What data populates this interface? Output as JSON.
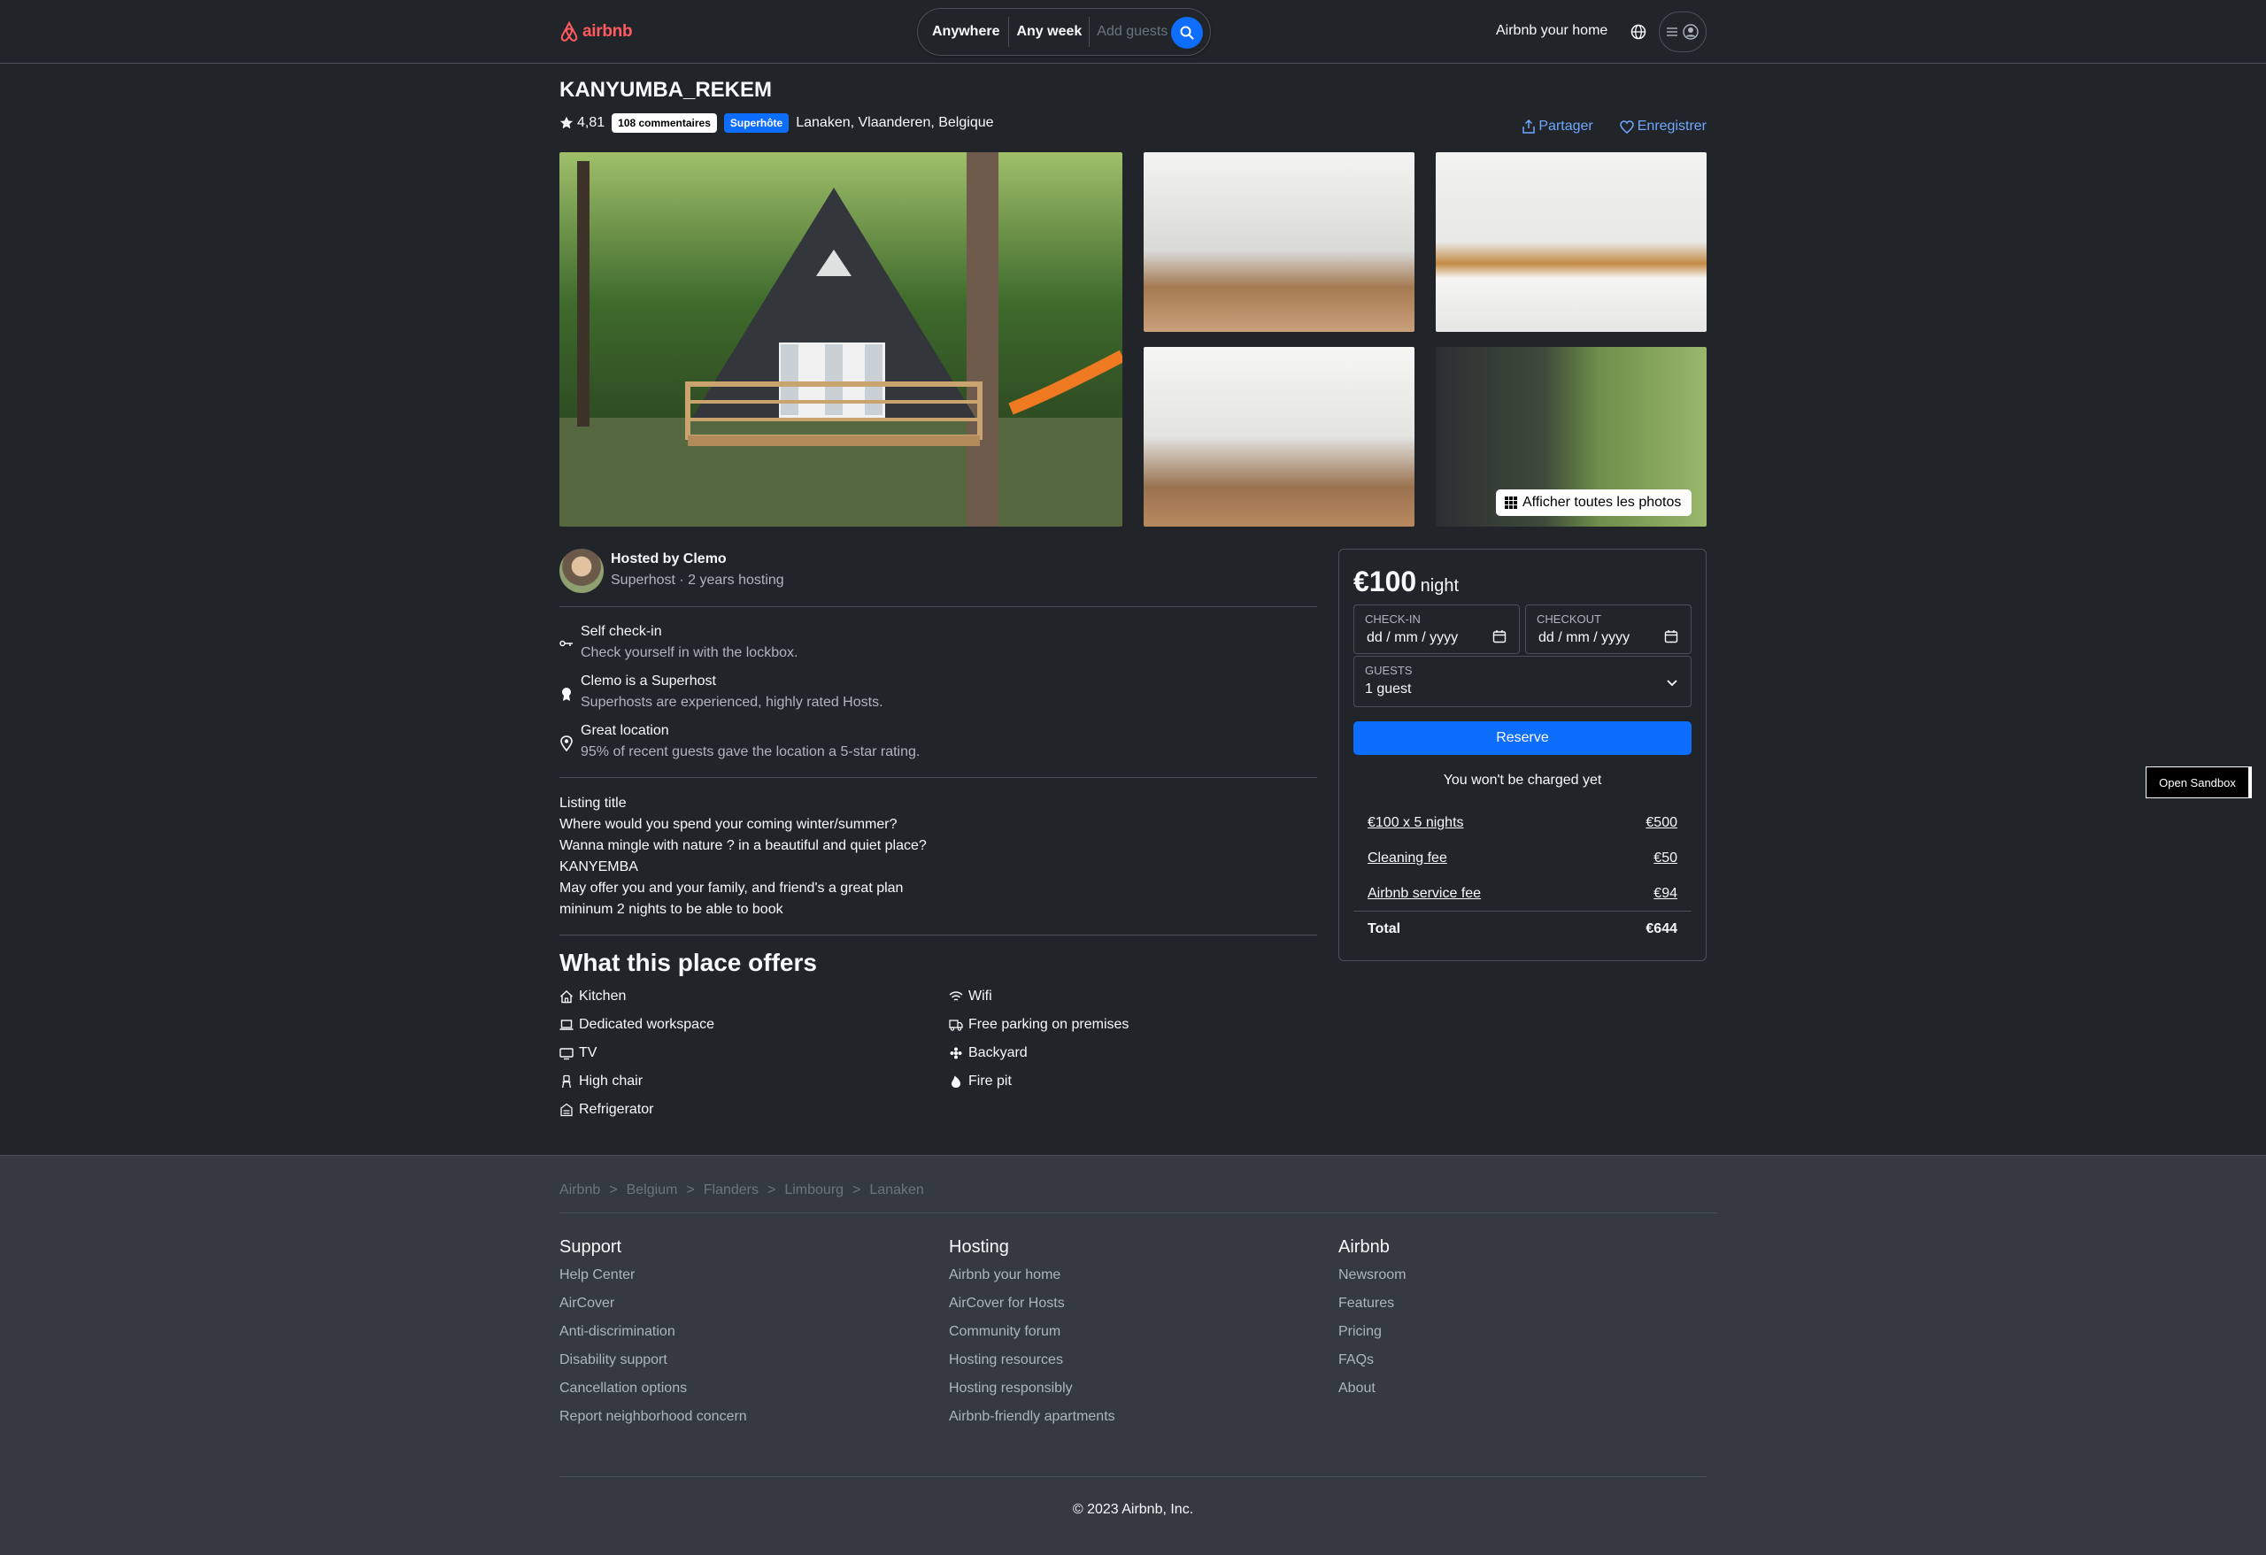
{
  "header": {
    "logo_text": "airbnb",
    "search": {
      "where": "Anywhere",
      "when": "Any week",
      "who_placeholder": "Add guests"
    },
    "host_link": "Airbnb your home"
  },
  "listing": {
    "title": "KANYUMBA_REKEM",
    "rating": "4,81",
    "reviews_badge": "108 commentaires",
    "superhost_badge": "Superhôte",
    "location": "Lanaken, Vlaanderen, Belgique",
    "share_label": "Partager",
    "save_label": "Enregistrer",
    "show_all_photos": "Afficher toutes les photos"
  },
  "host": {
    "hosted_by": "Hosted by Clemo",
    "subtitle": "Superhost · 2 years hosting"
  },
  "highlights": [
    {
      "icon": "key-icon",
      "title": "Self check-in",
      "subtitle": "Check yourself in with the lockbox."
    },
    {
      "icon": "medal-icon",
      "title": "Clemo is a Superhost",
      "subtitle": "Superhosts are experienced, highly rated Hosts."
    },
    {
      "icon": "location-pin-icon",
      "title": "Great location",
      "subtitle": "95% of recent guests gave the location a 5-star rating."
    }
  ],
  "description": {
    "lines": [
      "Listing title",
      "Where would you spend your coming winter/summer?",
      "Wanna mingle with nature ? in a beautiful and quiet place?",
      "KANYEMBA",
      "May offer you and your family, and friend's a great plan",
      "mininum 2 nights to be able to book"
    ]
  },
  "amenities": {
    "title": "What this place offers",
    "left": [
      {
        "icon": "kitchen-icon",
        "label": "Kitchen"
      },
      {
        "icon": "laptop-icon",
        "label": "Dedicated workspace"
      },
      {
        "icon": "tv-icon",
        "label": "TV"
      },
      {
        "icon": "high-chair-icon",
        "label": "High chair"
      },
      {
        "icon": "refrigerator-icon",
        "label": "Refrigerator"
      }
    ],
    "right": [
      {
        "icon": "wifi-icon",
        "label": "Wifi"
      },
      {
        "icon": "parking-icon",
        "label": "Free parking on premises"
      },
      {
        "icon": "backyard-icon",
        "label": "Backyard"
      },
      {
        "icon": "fire-icon",
        "label": "Fire pit"
      }
    ]
  },
  "booking": {
    "price": "€100",
    "price_unit": "night",
    "checkin_label": "CHECK-IN",
    "checkin_placeholder": "dd / mm / yyyy",
    "checkout_label": "CHECKOUT",
    "checkout_placeholder": "dd / mm / yyyy",
    "guests_label": "GUESTS",
    "guests_value": "1 guest",
    "reserve_label": "Reserve",
    "no_charge_note": "You won't be charged yet",
    "lines": [
      {
        "label": "€100 x 5 nights",
        "amount": "€500"
      },
      {
        "label": "Cleaning fee",
        "amount": "€50"
      },
      {
        "label": "Airbnb service fee",
        "amount": "€94"
      }
    ],
    "total_label": "Total",
    "total_amount": "€644"
  },
  "sandbox_button": "Open Sandbox",
  "footer": {
    "breadcrumbs": [
      "Airbnb",
      "Belgium",
      "Flanders",
      "Limbourg",
      "Lanaken"
    ],
    "separator": ">",
    "columns": [
      {
        "title": "Support",
        "links": [
          "Help Center",
          "AirCover",
          "Anti-discrimination",
          "Disability support",
          "Cancellation options",
          "Report neighborhood concern"
        ]
      },
      {
        "title": "Hosting",
        "links": [
          "Airbnb your home",
          "AirCover for Hosts",
          "Community forum",
          "Hosting resources",
          "Hosting responsibly",
          "Airbnb-friendly apartments"
        ]
      },
      {
        "title": "Airbnb",
        "links": [
          "Newsroom",
          "Features",
          "Pricing",
          "FAQs",
          "About"
        ]
      }
    ],
    "copyright": "© 2023 Airbnb, Inc."
  },
  "colors": {
    "background": "#212529",
    "footer_background": "#343a40",
    "accent": "#0d6efd",
    "brand": "#ff5a5f",
    "link": "#6ea8fe"
  }
}
